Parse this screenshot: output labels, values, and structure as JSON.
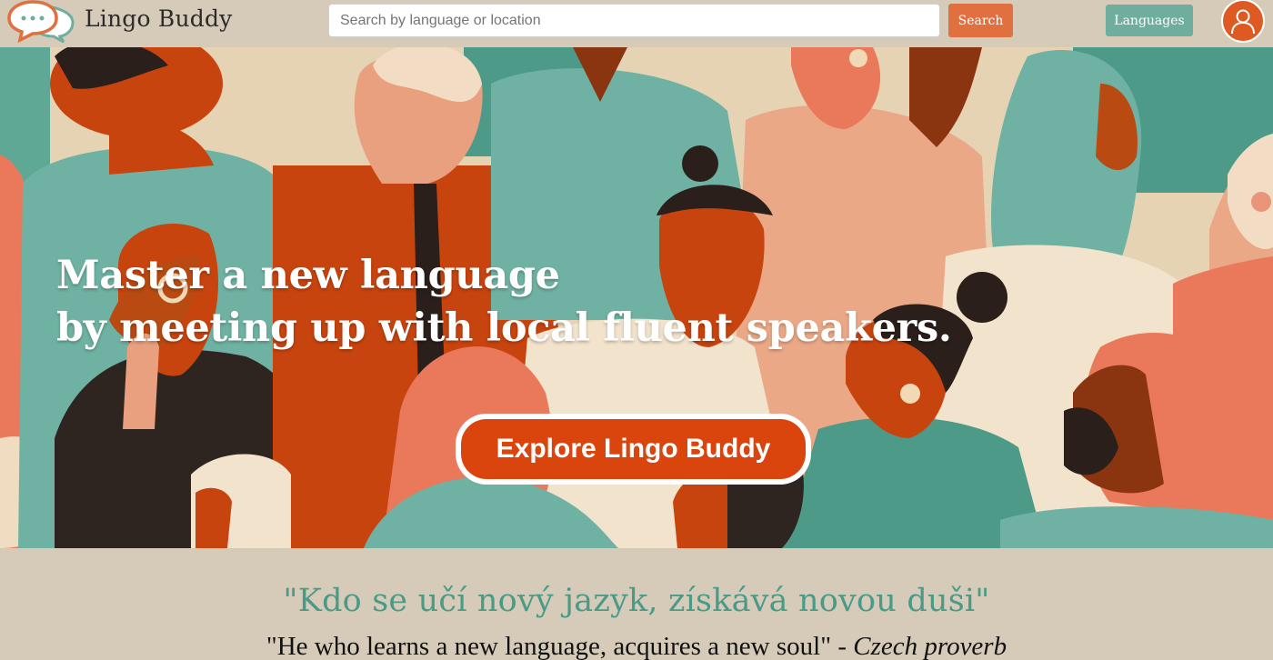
{
  "header": {
    "app_title": "Lingo Buddy",
    "search": {
      "placeholder": "Search by language or location",
      "value": ""
    },
    "search_button_label": "Search",
    "languages_button_label": "Languages",
    "avatar_icon": "user-icon"
  },
  "hero": {
    "title_line1": "Master a new language",
    "title_line2": "by meeting up with local fluent speakers.",
    "cta_label": "Explore Lingo Buddy"
  },
  "quote": {
    "original": "\"Kdo se učí nový jazyk, získává novou duši\"",
    "translation": "\"He who learns a new language, acquires a new soul\"",
    "separator": " - ",
    "attribution": "Czech proverb"
  },
  "colors": {
    "brand_orange": "#e0703f",
    "teal": "#6fae9e",
    "cta_red": "#d9450d",
    "header_bg": "#d6cbb9",
    "quote_green": "#4a9a88"
  }
}
